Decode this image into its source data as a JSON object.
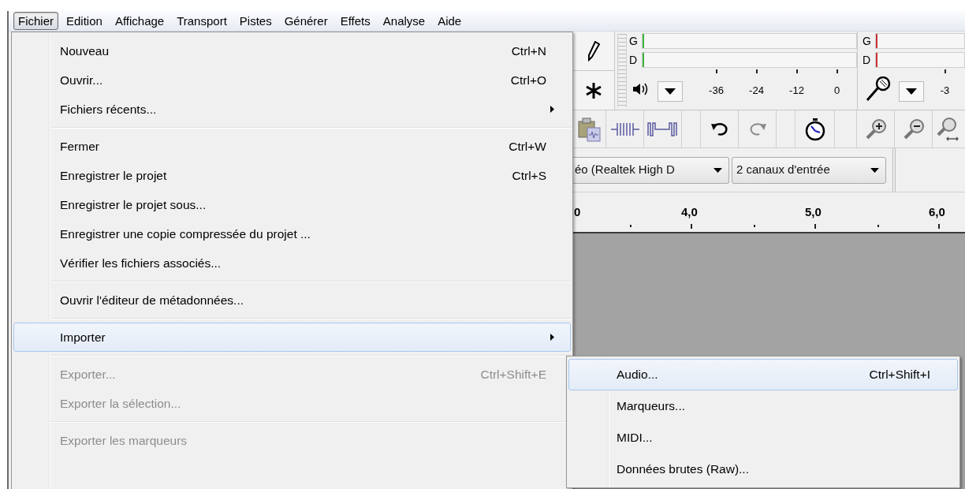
{
  "menu_bar": [
    {
      "label": "Fichier",
      "selected": true
    },
    {
      "label": "Edition",
      "selected": false
    },
    {
      "label": "Affichage",
      "selected": false
    },
    {
      "label": "Transport",
      "selected": false
    },
    {
      "label": "Pistes",
      "selected": false
    },
    {
      "label": "Générer",
      "selected": false
    },
    {
      "label": "Effets",
      "selected": false
    },
    {
      "label": "Analyse",
      "selected": false
    },
    {
      "label": "Aide",
      "selected": false
    }
  ],
  "file_menu": [
    {
      "kind": "item",
      "label": "Nouveau",
      "shortcut": "Ctrl+N",
      "disabled": false,
      "selected": false
    },
    {
      "kind": "item",
      "label": "Ouvrir...",
      "shortcut": "Ctrl+O",
      "disabled": false,
      "selected": false
    },
    {
      "kind": "submenu",
      "label": "Fichiers récents...",
      "disabled": false,
      "selected": false
    },
    {
      "kind": "separator"
    },
    {
      "kind": "item",
      "label": "Fermer",
      "shortcut": "Ctrl+W",
      "disabled": false,
      "selected": false
    },
    {
      "kind": "item",
      "label": "Enregistrer le projet",
      "shortcut": "Ctrl+S",
      "disabled": false,
      "selected": false
    },
    {
      "kind": "item",
      "label": "Enregistrer le projet sous...",
      "disabled": false,
      "selected": false
    },
    {
      "kind": "item",
      "label": "Enregistrer une copie compressée du projet ...",
      "disabled": false,
      "selected": false
    },
    {
      "kind": "item",
      "label": "Vérifier les fichiers associés...",
      "disabled": false,
      "selected": false
    },
    {
      "kind": "separator"
    },
    {
      "kind": "item",
      "label": "Ouvrir l'éditeur de métadonnées...",
      "disabled": false,
      "selected": false
    },
    {
      "kind": "separator"
    },
    {
      "kind": "submenu",
      "label": "Importer",
      "disabled": false,
      "selected": true
    },
    {
      "kind": "separator"
    },
    {
      "kind": "item",
      "label": "Exporter...",
      "shortcut": "Ctrl+Shift+E",
      "disabled": true,
      "selected": false
    },
    {
      "kind": "item",
      "label": "Exporter la sélection...",
      "disabled": true,
      "selected": false
    },
    {
      "kind": "separator"
    },
    {
      "kind": "item",
      "label": "Exporter les marqueurs",
      "disabled": true,
      "selected": false
    }
  ],
  "import_submenu": [
    {
      "label": "Audio...",
      "shortcut": "Ctrl+Shift+I",
      "selected": true
    },
    {
      "label": "Marqueurs...",
      "selected": false
    },
    {
      "label": "MIDI...",
      "selected": false
    },
    {
      "label": "Données brutes (Raw)...",
      "selected": false
    }
  ],
  "meters": [
    {
      "kind": "playback",
      "color": "#3fb43f",
      "channels": [
        "G",
        "D"
      ],
      "scale": [
        "-36",
        "-24",
        "-12",
        "0"
      ]
    },
    {
      "kind": "recording",
      "color": "#c83232",
      "channels": [
        "G",
        "D"
      ],
      "scale": [
        "-3"
      ]
    }
  ],
  "devices": [
    {
      "label": "éo (Realtek High D"
    },
    {
      "label": "2 canaux d'entrée"
    }
  ],
  "ruler": [
    "0",
    "4,0",
    "5,0",
    "6,0"
  ]
}
